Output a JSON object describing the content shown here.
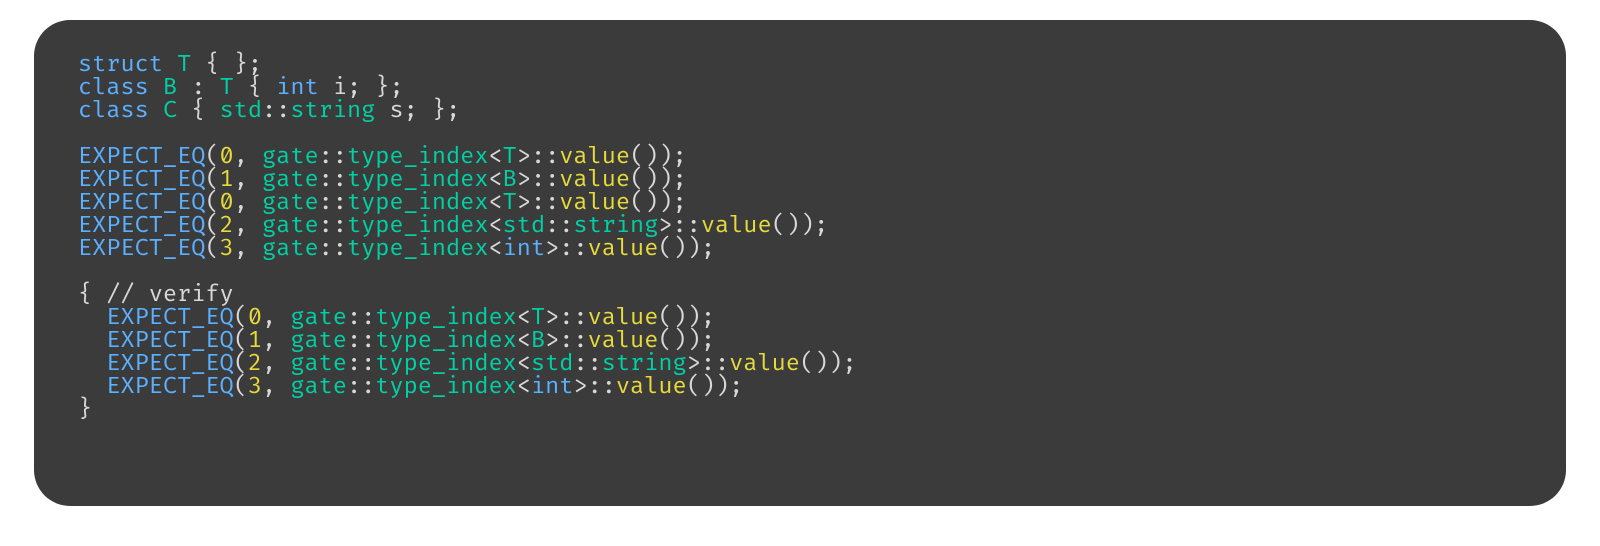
{
  "code": {
    "decl": {
      "struct_kw": "struct",
      "T": "T",
      "brace_empty": "{ }",
      "semi": ";",
      "class_kw": "class",
      "B": "B",
      "colon": ":",
      "int_kw": "int",
      "i_field": "i",
      "C": "C",
      "std": "std",
      "dcolon": "::",
      "string": "string",
      "s_field": "s"
    },
    "macro": "EXPECT_EQ",
    "gate": "gate",
    "type_index": "type_index",
    "value": "value",
    "std": "std",
    "string": "string",
    "int": "int",
    "T": "T",
    "B": "B",
    "nums": {
      "n0": "0",
      "n1": "1",
      "n2": "2",
      "n3": "3"
    },
    "verify_cmnt": "// verify",
    "p": {
      "lb": "{",
      "rb": "}",
      "lp": "(",
      "rp": ")",
      "lt": "<",
      "gt": ">",
      "comma": ",",
      "semi": ";",
      "dcolon": "::",
      "space": " ",
      "colon": ":"
    }
  }
}
